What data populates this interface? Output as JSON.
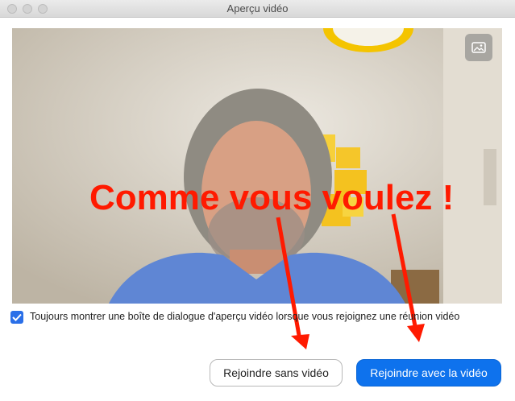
{
  "window": {
    "title": "Aperçu vidéo"
  },
  "video": {
    "background_button_icon": "image-icon"
  },
  "annotation": {
    "text": "Comme vous voulez !",
    "color": "#ff1a00"
  },
  "preview_checkbox": {
    "checked": true,
    "label": "Toujours montrer une boîte de dialogue d'aperçu vidéo lorsque vous rejoignez une réunion vidéo"
  },
  "buttons": {
    "join_without_video": "Rejoindre sans vidéo",
    "join_with_video": "Rejoindre avec la vidéo"
  },
  "colors": {
    "primary": "#0e72ed",
    "checkbox": "#2a6fe8",
    "annotation": "#ff1a00"
  }
}
